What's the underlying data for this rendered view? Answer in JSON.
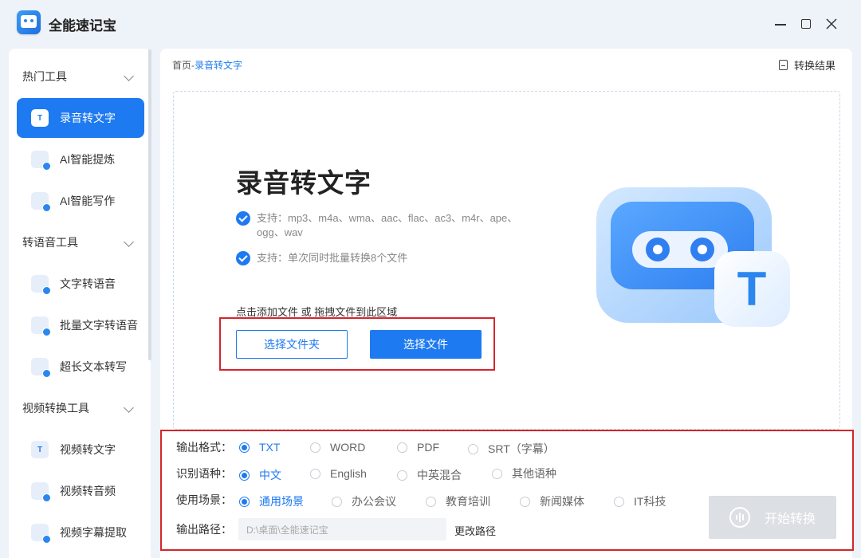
{
  "app": {
    "title": "全能速记宝"
  },
  "sidebar": {
    "groups": [
      {
        "label": "热门工具"
      },
      {
        "label": "转语音工具"
      },
      {
        "label": "视频转换工具"
      }
    ],
    "items": [
      {
        "label": "录音转文字",
        "icon": "T",
        "active": true
      },
      {
        "label": "AI智能提炼",
        "icon": "ai-refine-icon"
      },
      {
        "label": "AI智能写作",
        "icon": "ai-write-icon"
      },
      {
        "label": "文字转语音",
        "icon": "tts-icon"
      },
      {
        "label": "批量文字转语音",
        "icon": "batch-tts-icon"
      },
      {
        "label": "超长文本转写",
        "icon": "long-text-icon"
      },
      {
        "label": "视频转文字",
        "icon": "T"
      },
      {
        "label": "视频转音频",
        "icon": "video-audio-icon"
      },
      {
        "label": "视频字幕提取",
        "icon": "subtitle-icon"
      }
    ]
  },
  "main": {
    "breadcrumb_home": "首页",
    "breadcrumb_sep": "-",
    "breadcrumb_current": "录音转文字",
    "result_link": "转换结果",
    "hero_title": "录音转文字",
    "support_formats": "支持：mp3、m4a、wma、aac、flac、ac3、m4r、ape、",
    "support_formats_2": "ogg、wav",
    "support_batch": "支持：单次同时批量转换8个文件",
    "drop_hint": "点击添加文件 或 拖拽文件到此区域",
    "btn_select_folder": "选择文件夹",
    "btn_select_file": "选择文件",
    "illustration_letter": "T"
  },
  "settings": {
    "output_format": {
      "label": "输出格式：",
      "options": [
        "TXT",
        "WORD",
        "PDF",
        "SRT（字幕）"
      ],
      "selected": "TXT"
    },
    "language": {
      "label": "识别语种：",
      "options": [
        "中文",
        "English",
        "中英混合",
        "其他语种"
      ],
      "selected": "中文"
    },
    "scene": {
      "label": "使用场景：",
      "options": [
        "通用场景",
        "办公会议",
        "教育培训",
        "新闻媒体",
        "IT科技"
      ],
      "selected": "通用场景"
    },
    "output_path": {
      "label": "输出路径：",
      "value": "D:\\桌面\\全能速记宝",
      "change_label": "更改路径"
    },
    "start_button": "开始转换"
  },
  "colors": {
    "accent": "#1e7af0",
    "highlight": "#d4262a",
    "disabled": "#dcdfe3"
  }
}
